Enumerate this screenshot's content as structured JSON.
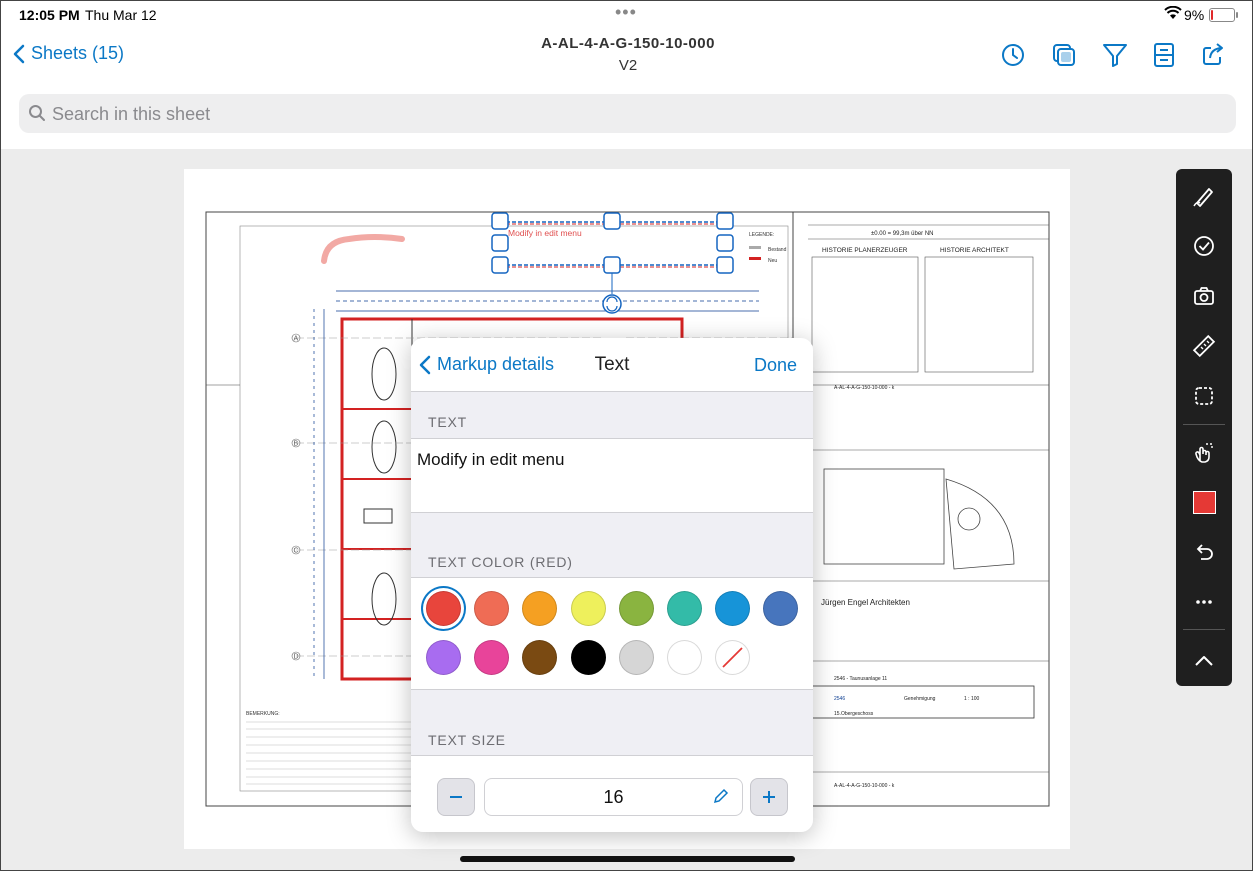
{
  "status": {
    "time": "12:05 PM",
    "date": "Thu Mar 12",
    "battery": "9%",
    "battery_level": 0.09
  },
  "nav": {
    "back_label": "Sheets (15)",
    "title": "A-AL-4-A-G-150-10-000",
    "version": "V2",
    "icons": [
      "history-icon",
      "layers-icon",
      "filter-icon",
      "sheet-info-icon",
      "share-icon"
    ]
  },
  "search": {
    "placeholder": "Search in this sheet"
  },
  "drawing": {
    "markup_text": "Modify in edit menu",
    "legend_title": "LEGENDE:",
    "legend_existing": "Bestand",
    "legend_new": "Neu",
    "elevation": "±0.00 = 99,3m über NN",
    "history_left": "HISTORIE PLANERZEUGER",
    "history_right": "HISTORIE ARCHITEKT",
    "sheet_code": "A-AL-4-A-G-150-10-000 - k",
    "firm": "Jürgen Engel Architekten",
    "project": "2546 - Taunusanlage 11",
    "project_no": "2546",
    "phase": "Genehmigung",
    "scale": "1 : 100",
    "level": "15.Obergeschoss",
    "remarks_title": "BEMERKUNG:",
    "grid_labels": [
      "A",
      "B",
      "C",
      "D"
    ]
  },
  "toolbar": {
    "tools": [
      "pen-icon",
      "check-icon",
      "camera-icon",
      "ruler-icon",
      "selection-icon",
      "gesture-icon",
      "color-swatch",
      "undo-icon",
      "more-icon",
      "collapse-icon"
    ],
    "active_color": "#e53935"
  },
  "markup_panel": {
    "back_label": "Markup details",
    "title": "Text",
    "done_label": "Done",
    "text_section": "TEXT",
    "text_value": "Modify in edit menu",
    "color_section": "TEXT COLOR (RED)",
    "colors": [
      "#e8453c",
      "#ef6c55",
      "#f5a022",
      "#eef05c",
      "#8ab440",
      "#33bba8",
      "#1794d8",
      "#4775bd",
      "#a86cf0",
      "#e8449a",
      "#7a4a12",
      "#000000",
      "#d6d6d6",
      "#ffffff",
      "none"
    ],
    "selected_color": "#e8453c",
    "size_section": "TEXT SIZE",
    "size_value": "16"
  }
}
